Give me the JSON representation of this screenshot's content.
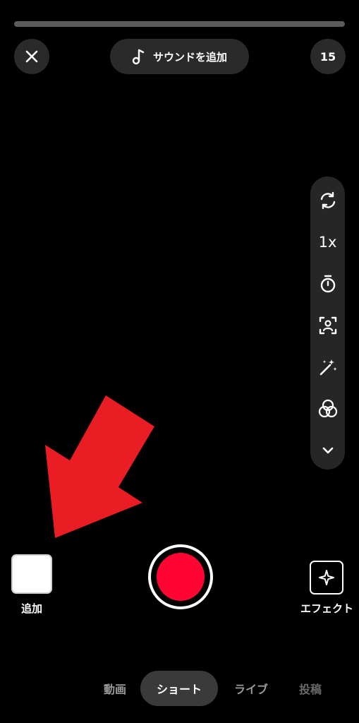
{
  "recording_progress": 0,
  "top_bar": {
    "close_icon": "close-icon",
    "sound_label": "サウンドを追加",
    "sound_icon": "music-note-icon",
    "duration_label": "15"
  },
  "tool_rail": {
    "items": [
      {
        "name": "flip-camera",
        "icon": "flip-camera-icon"
      },
      {
        "name": "speed",
        "icon": "speed-icon",
        "label": "1x"
      },
      {
        "name": "timer",
        "icon": "timer-icon"
      },
      {
        "name": "green-screen",
        "icon": "green-screen-icon"
      },
      {
        "name": "retouch",
        "icon": "magic-wand-icon"
      },
      {
        "name": "filters",
        "icon": "filters-icon"
      },
      {
        "name": "more",
        "icon": "chevron-down-icon"
      }
    ]
  },
  "annotation": {
    "arrow_color": "#ea1c24"
  },
  "bottom_controls": {
    "add_label": "追加",
    "effect_label": "エフェクト",
    "record_color": "#ff0533"
  },
  "mode_tabs": [
    {
      "label": "動画",
      "state": "inactive"
    },
    {
      "label": "ショート",
      "state": "active"
    },
    {
      "label": "ライブ",
      "state": "inactive"
    },
    {
      "label": "投稿",
      "state": "disabled"
    }
  ]
}
